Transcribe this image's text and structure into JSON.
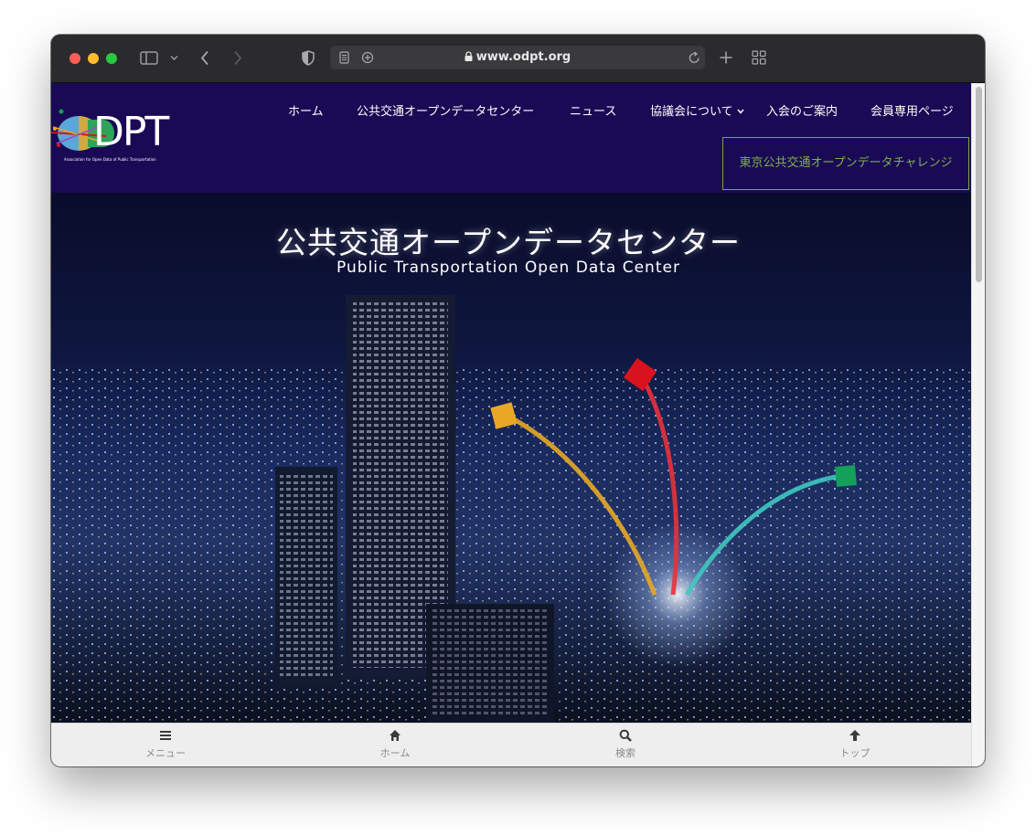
{
  "browser": {
    "url": "www.odpt.org"
  },
  "site": {
    "logo": {
      "text": "DPT",
      "tagline": "Association for Open Data of Public Transportation"
    },
    "nav": [
      {
        "label": "ホーム"
      },
      {
        "label": "公共交通オープンデータセンター"
      },
      {
        "label": "ニュース"
      },
      {
        "label": "協議会について"
      },
      {
        "label": "入会のご案内"
      },
      {
        "label": "会員専用ページ"
      }
    ],
    "cta_label": "東京公共交通オープンデータチャレンジ"
  },
  "hero": {
    "title": "公共交通オープンデータセンター",
    "subtitle": "Public Transportation Open Data Center"
  },
  "bottom_nav": [
    {
      "label": "メニュー",
      "icon": "menu-icon"
    },
    {
      "label": "ホーム",
      "icon": "home-icon"
    },
    {
      "label": "検索",
      "icon": "search-icon"
    },
    {
      "label": "トップ",
      "icon": "arrow-up-icon"
    }
  ],
  "colors": {
    "header_bg": "#1a0a55",
    "cta_accent": "#7fb04a",
    "cube_yellow": "#e8a826",
    "cube_red": "#d8121e",
    "cube_green": "#14a05a"
  }
}
